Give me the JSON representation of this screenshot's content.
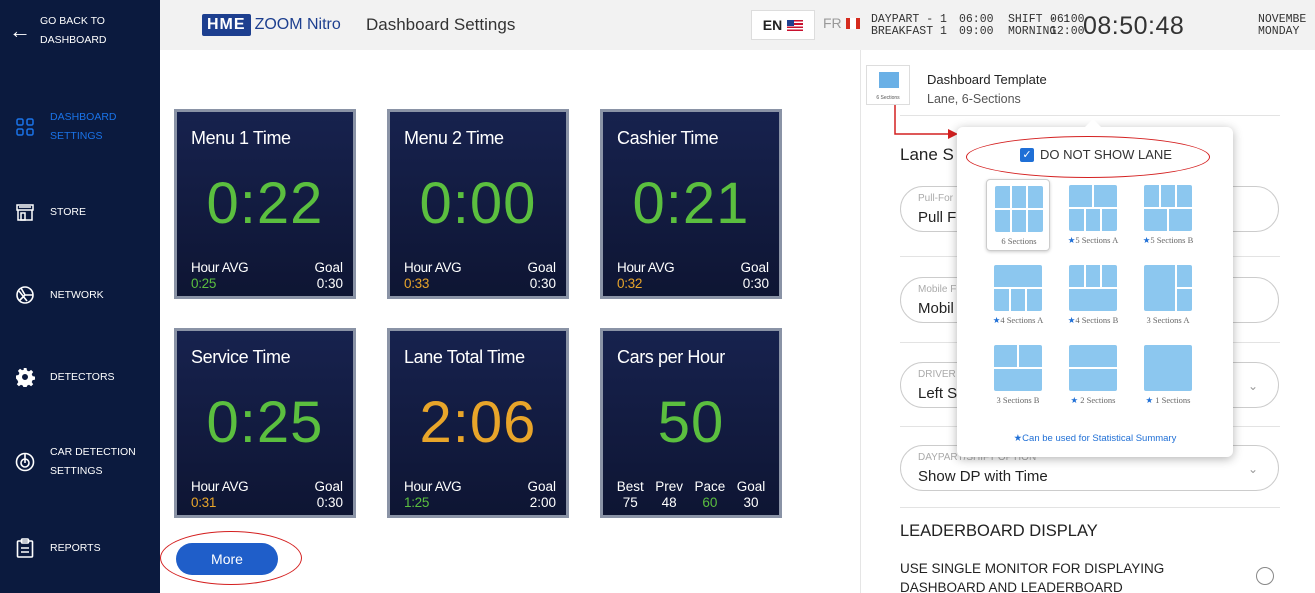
{
  "sidebar": {
    "back_label": "GO BACK TO DASHBOARD",
    "items": [
      {
        "label": "DASHBOARD SETTINGS",
        "icon": "dashboard-icon"
      },
      {
        "label": "STORE",
        "icon": "store-icon"
      },
      {
        "label": "NETWORK",
        "icon": "network-icon"
      },
      {
        "label": "DETECTORS",
        "icon": "gear-icon"
      },
      {
        "label": "CAR DETECTION SETTINGS",
        "icon": "car-detection-icon"
      },
      {
        "label": "REPORTS",
        "icon": "clipboard-icon"
      }
    ]
  },
  "header": {
    "brand": "HME",
    "product": "ZOOM Nitro",
    "title": "Dashboard Settings",
    "lang_en": "EN",
    "lang_fr": "FR",
    "daypart_label": "DAYPART - 1",
    "daypart_name": "BREAKFAST 1",
    "daypart_start": "06:00",
    "daypart_end": "09:00",
    "shift_label": "SHIFT - 1",
    "shift_name": "MORNING",
    "shift_start": "06:00",
    "shift_end": "12:00",
    "clock": "08:50:48",
    "month": "NOVEMBE",
    "weekday": "MONDAY"
  },
  "tiles": [
    {
      "title": "Menu 1 Time",
      "value": "0:22",
      "avg_label": "Hour AVG",
      "avg": "0:25",
      "goal_label": "Goal",
      "goal": "0:30"
    },
    {
      "title": "Menu 2 Time",
      "value": "0:00",
      "avg_label": "Hour AVG",
      "avg": "0:33",
      "goal_label": "Goal",
      "goal": "0:30"
    },
    {
      "title": "Cashier Time",
      "value": "0:21",
      "avg_label": "Hour AVG",
      "avg": "0:32",
      "goal_label": "Goal",
      "goal": "0:30"
    },
    {
      "title": "Service Time",
      "value": "0:25",
      "avg_label": "Hour AVG",
      "avg": "0:31",
      "goal_label": "Goal",
      "goal": "0:30"
    },
    {
      "title": "Lane Total Time",
      "value": "2:06",
      "avg_label": "Hour AVG",
      "avg": "1:25",
      "goal_label": "Goal",
      "goal": "2:00"
    },
    {
      "title": "Cars per Hour",
      "value": "50",
      "stats": [
        {
          "label": "Best",
          "value": "75"
        },
        {
          "label": "Prev",
          "value": "48"
        },
        {
          "label": "Pace",
          "value": "60"
        },
        {
          "label": "Goal",
          "value": "30"
        }
      ]
    }
  ],
  "more_label": "More",
  "panel": {
    "template_title": "Dashboard Template",
    "template_sub": "Lane, 6-Sections",
    "template_icon_label": "6 Sections",
    "lane_heading": "Lane S",
    "field1_label": "Pull-For",
    "field1_value": "Pull F",
    "field2_label": "Mobile F",
    "field2_value": "Mobil",
    "field3_label": "DRIVER",
    "field3_value": "Left S",
    "field4_label": "DAYPART/SHIFT OPTION",
    "field4_value": "Show DP with Time",
    "leaderboard_heading": "LEADERBOARD DISPLAY",
    "single_monitor_label": "USE SINGLE MONITOR FOR DISPLAYING DASHBOARD AND LEADERBOARD"
  },
  "popup": {
    "do_not_show_lane": "DO NOT SHOW LANE",
    "options": [
      {
        "label": "6 Sections",
        "star": false
      },
      {
        "label": "5 Sections A",
        "star": true
      },
      {
        "label": "5 Sections B",
        "star": true
      },
      {
        "label": "4 Sections A",
        "star": true
      },
      {
        "label": "4 Sections B",
        "star": true
      },
      {
        "label": "3 Sections A",
        "star": false
      },
      {
        "label": "3 Sections B",
        "star": false
      },
      {
        "label": "2 Sections",
        "star": true
      },
      {
        "label": "1 Sections",
        "star": true
      }
    ],
    "note": "Can be used for Statistical Summary"
  },
  "colors": {
    "sidebar": "#0b1a3e",
    "accent": "#1f6fd6",
    "good": "#5bbf3f",
    "warn": "#e8a52a",
    "annotation": "#d42020"
  }
}
